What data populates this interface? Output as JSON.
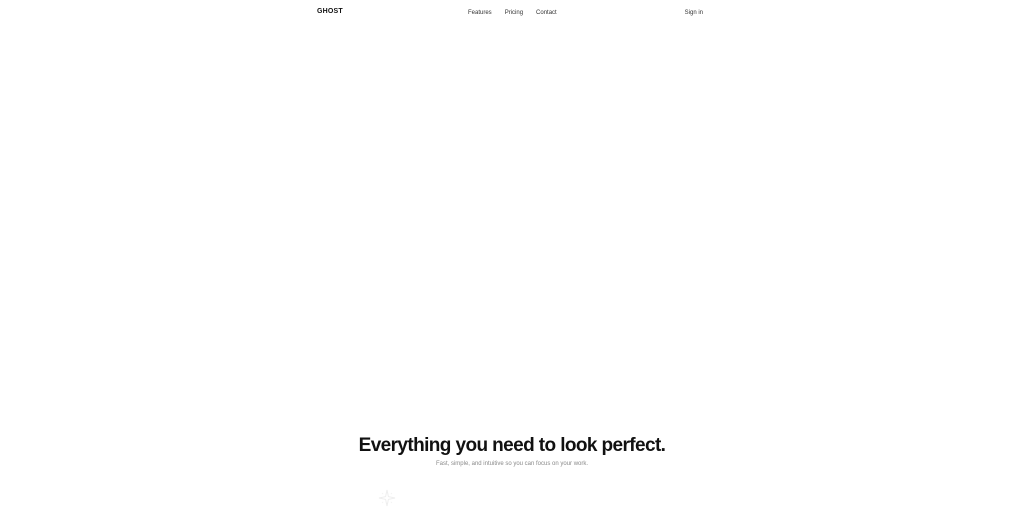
{
  "header": {
    "logo": "GHOST",
    "nav": [
      "Features",
      "Pricing",
      "Contact"
    ],
    "sign_in": "Sign in"
  },
  "hero": {
    "title": "Everything you need to look perfect.",
    "subtitle": "Fast, simple, and intuitive so you can focus on your work."
  },
  "decoration": {
    "icon": "sparkle-icon",
    "color": "#cfcfcf"
  }
}
